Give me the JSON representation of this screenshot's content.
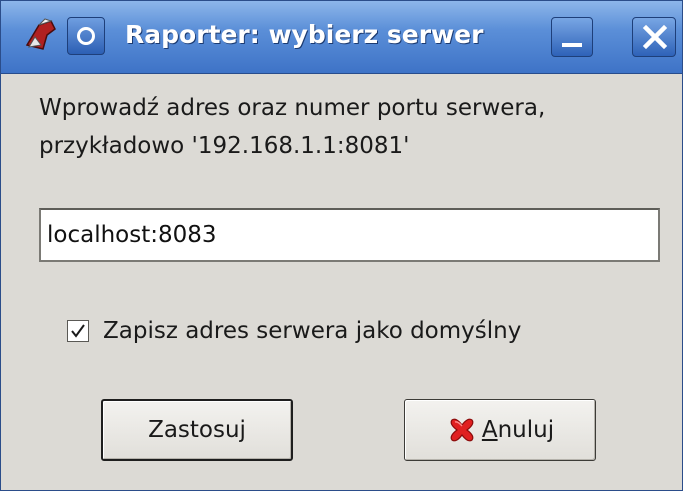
{
  "window": {
    "title": "Raporter: wybierz serwer"
  },
  "titlebar": {
    "app_icon": "app-logo-icon",
    "menu_icon": "window-menu-icon",
    "minimize_icon": "minimize-icon",
    "close_icon": "close-icon"
  },
  "dialog": {
    "message_line1": "Wprowadź adres oraz numer portu serwera,",
    "message_line2": "przykładowo '192.168.1.1:8081'",
    "address_value": "localhost:8083",
    "save_default_label": "Zapisz adres serwera jako domyślny",
    "save_default_checked": true,
    "apply_label": "Zastosuj",
    "cancel_label": "Anuluj",
    "cancel_icon": "cancel-x-icon"
  },
  "colors": {
    "titlebar_blue": "#3e73c7",
    "window_bg": "#dcdad5",
    "cancel_red": "#e02020"
  }
}
